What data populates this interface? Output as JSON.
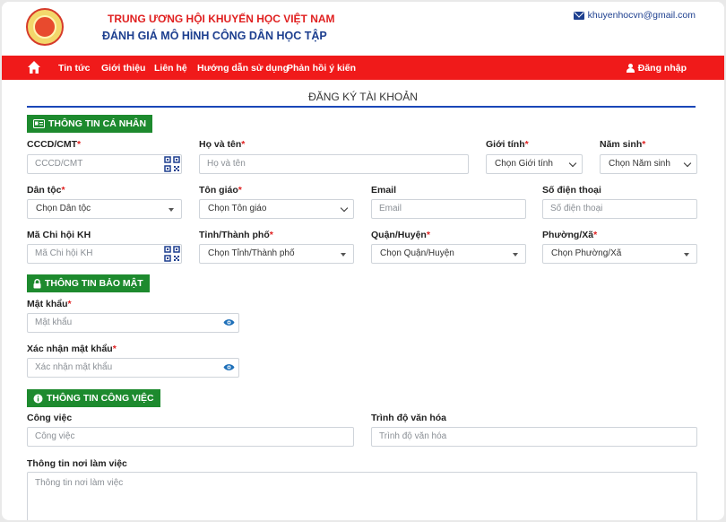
{
  "header": {
    "org_name": "TRUNG ƯƠNG HỘI KHUYẾN HỌC VIỆT NAM",
    "app_name": "ĐÁNH GIÁ MÔ HÌNH CÔNG DÂN HỌC TẬP",
    "email": "khuyenhocvn@gmail.com"
  },
  "nav": {
    "items": [
      "Tin tức",
      "Giới thiệu",
      "Liên hệ",
      "Hướng dẫn sử dụng",
      "Phản hồi ý kiến"
    ],
    "login": "Đăng nhập"
  },
  "page_title": "ĐĂNG KÝ TÀI KHOẢN",
  "sections": {
    "personal": "THÔNG TIN CÁ NHÂN",
    "security": "THÔNG TIN BẢO MẬT",
    "work": "THÔNG TIN CÔNG VIỆC"
  },
  "fields": {
    "cccd": {
      "label": "CCCD/CMT",
      "placeholder": "CCCD/CMT"
    },
    "fullname": {
      "label": "Họ và tên",
      "placeholder": "Họ và tên"
    },
    "gender": {
      "label": "Giới tính",
      "value": "Chọn Giới tính"
    },
    "birthyear": {
      "label": "Năm sinh",
      "value": "Chọn Năm sinh"
    },
    "ethnicity": {
      "label": "Dân tộc",
      "value": "Chọn Dân tộc"
    },
    "religion": {
      "label": "Tôn giáo",
      "value": "Chọn Tôn giáo"
    },
    "email": {
      "label": "Email",
      "placeholder": "Email"
    },
    "phone": {
      "label": "Số điện thoại",
      "placeholder": "Số điện thoại"
    },
    "branch": {
      "label": "Mã Chi hội KH",
      "placeholder": "Mã Chi hội KH"
    },
    "province": {
      "label": "Tỉnh/Thành phố",
      "value": "Chọn Tỉnh/Thành phố"
    },
    "district": {
      "label": "Quận/Huyện",
      "value": "Chọn Quận/Huyện"
    },
    "ward": {
      "label": "Phường/Xã",
      "value": "Chọn Phường/Xã"
    },
    "password": {
      "label": "Mật khẩu",
      "placeholder": "Mật khẩu"
    },
    "confirm_password": {
      "label": "Xác nhận mật khẩu",
      "placeholder": "Xác nhận mật khẩu"
    },
    "job": {
      "label": "Công việc",
      "placeholder": "Công việc"
    },
    "education": {
      "label": "Trình độ văn hóa",
      "placeholder": "Trình độ văn hóa"
    },
    "workplace": {
      "label": "Thông tin nơi làm việc",
      "placeholder": "Thông tin nơi làm việc"
    }
  },
  "required_mark": "*",
  "colors": {
    "nav": "#f01a1a",
    "section": "#1d8a2e",
    "title_blue": "#1d3f8f",
    "org_red": "#e02020"
  }
}
